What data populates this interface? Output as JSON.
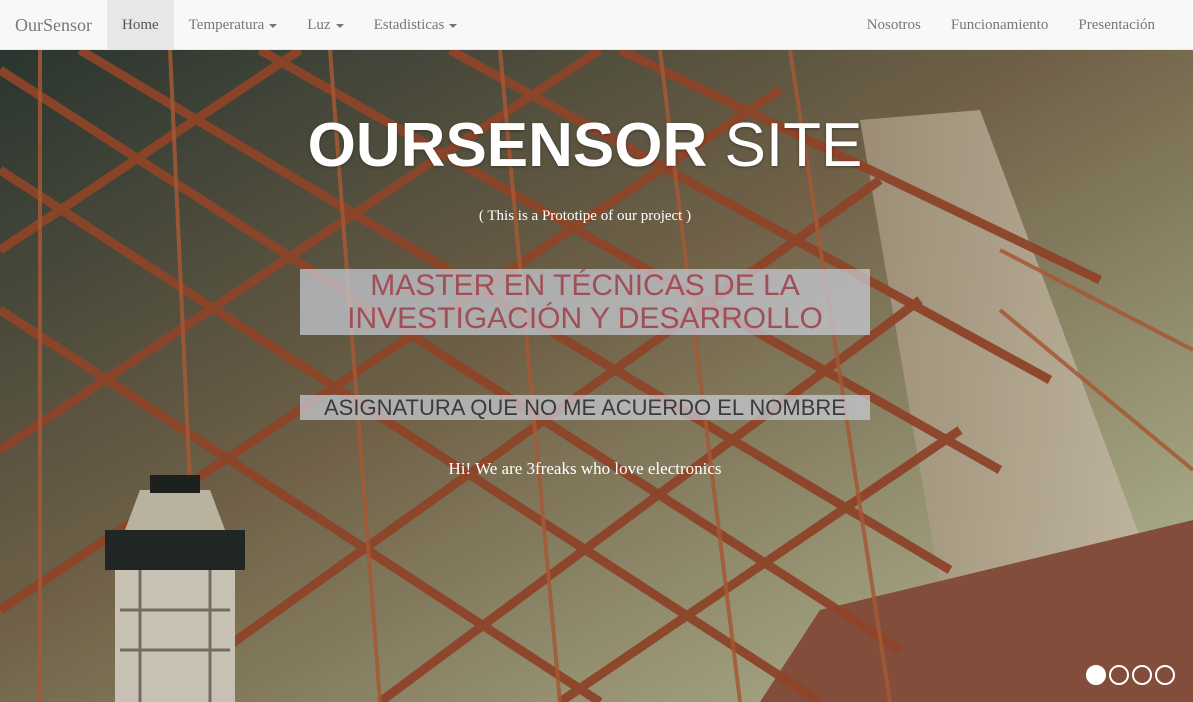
{
  "navbar": {
    "brand": "OurSensor",
    "left_items": [
      {
        "label": "Home",
        "active": true,
        "dropdown": false
      },
      {
        "label": "Temperatura",
        "active": false,
        "dropdown": true
      },
      {
        "label": "Luz",
        "active": false,
        "dropdown": true
      },
      {
        "label": "Estadisticas",
        "active": false,
        "dropdown": true
      }
    ],
    "right_items": [
      {
        "label": "Nosotros"
      },
      {
        "label": "Funcionamiento"
      },
      {
        "label": "Presentación"
      }
    ]
  },
  "hero": {
    "title_bold": "OURSENSOR",
    "title_light": "SITE",
    "subtitle": "( This is a Prototipe of our project )",
    "master_line1": "MASTER EN TÉCNICAS DE LA",
    "master_line2": "INVESTIGACIÓN Y DESARROLLO",
    "asignatura": "ASIGNATURA QUE NO ME ACUERDO EL NOMBRE",
    "tagline": "Hi! We are 3freaks who love electronics",
    "background": "bridge-photo",
    "slides_total": 4,
    "active_slide": 1
  },
  "colors": {
    "navbar_bg": "#f8f8f8",
    "nav_text": "#777777",
    "master_text": "#a14f57"
  }
}
